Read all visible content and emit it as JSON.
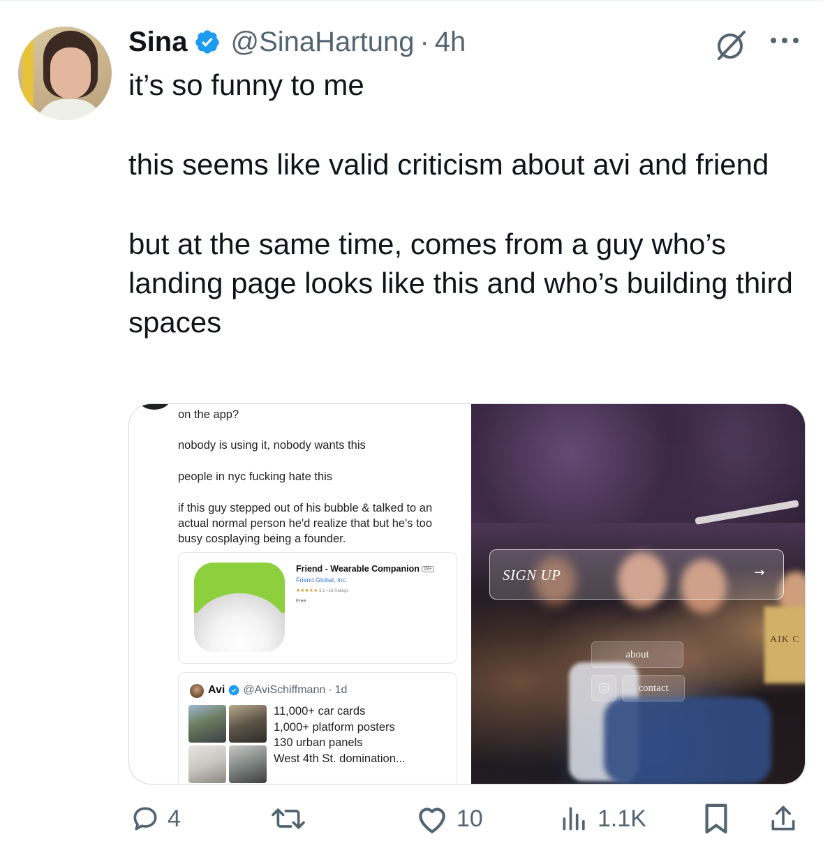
{
  "tweet": {
    "author_name": "Sina",
    "handle": "@SinaHartung",
    "separator": "·",
    "time": "4h",
    "text_lines": [
      "it’s so funny to me",
      "this seems like valid criticism about avi and friend",
      "but at the same time, comes from a guy who’s landing page looks like this and who’s building third spaces"
    ]
  },
  "media": {
    "left": {
      "lines": [
        "on the app?",
        "nobody is using it, nobody wants this",
        "people in nyc fucking hate this",
        "if this guy stepped out of his bubble & talked to an actual normal person he'd realize that but he's too busy cosplaying being a founder."
      ],
      "app_card": {
        "title": "Friend - Wearable Companion",
        "age_badge": "18+",
        "developer": "Friend Global, Inc.",
        "stars": "★★★★★",
        "rating_text": "3.1 • 18 Ratings",
        "price": "Free"
      },
      "quoted": {
        "name": "Avi",
        "handle": "@AviSchiffmann",
        "separator": "·",
        "time": "1d",
        "text": "11,000+ car cards\n1,000+ platform posters\n130 urban panels\nWest 4th St. domination..."
      }
    },
    "right": {
      "signup_label": "SIGN UP",
      "signup_arrow": "→",
      "about_label": "about",
      "contact_label": "contact",
      "shirt_text": "AIK C"
    }
  },
  "actions": {
    "replies": "4",
    "retweets": "",
    "likes": "10",
    "views": "1.1K"
  },
  "colors": {
    "verified": "#1d9bf0",
    "secondary_text": "#536471",
    "primary_text": "#0f1419"
  },
  "icons": {
    "reply": "reply-icon",
    "retweet": "retweet-icon",
    "like": "heart-icon",
    "views": "views-icon",
    "bookmark": "bookmark-icon",
    "share": "share-icon",
    "grok": "grok-icon",
    "more": "more-icon"
  }
}
